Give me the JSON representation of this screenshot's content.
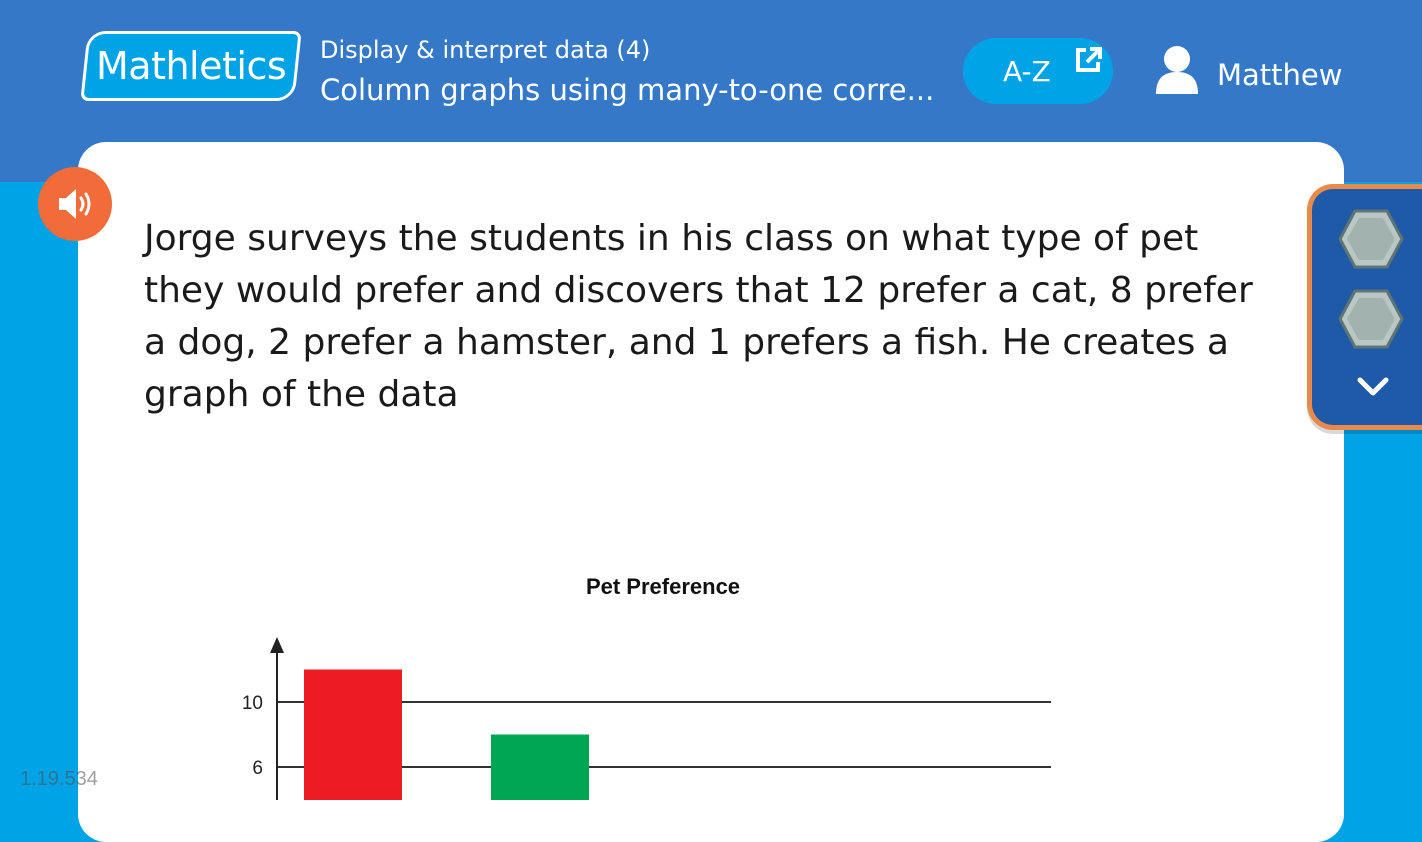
{
  "header": {
    "logo_text": "Mathletics",
    "breadcrumb_topic": "Display & interpret data (4)",
    "breadcrumb_lesson": "Column graphs using many-to-one corre...",
    "az_label": "A-Z",
    "user_name": "Matthew"
  },
  "colors": {
    "topbar": "#3578c8",
    "background": "#00a3e6",
    "speaker": "#f26b3a",
    "panel": "#1e5aa7",
    "panel_border": "#e9894a"
  },
  "icons": {
    "speaker": "speaker-icon",
    "external": "external-link-icon",
    "user": "user-icon",
    "hex": "hexagon-icon",
    "chevron": "chevron-down-icon"
  },
  "question": {
    "text": "Jorge surveys the students in his class on what type of pet they would prefer and discovers that 12 prefer a cat, 8 prefer a dog, 2 prefer a hamster, and 1 prefers a fish. He creates a graph of the data"
  },
  "chart_data": {
    "type": "bar",
    "title": "Pet Preference",
    "categories": [
      "",
      ""
    ],
    "values": [
      12,
      8
    ],
    "colors": [
      "#ec1c24",
      "#00a651"
    ],
    "y_ticks": [
      10,
      6
    ],
    "grid": true
  },
  "footer": {
    "version": "1.19.534"
  }
}
